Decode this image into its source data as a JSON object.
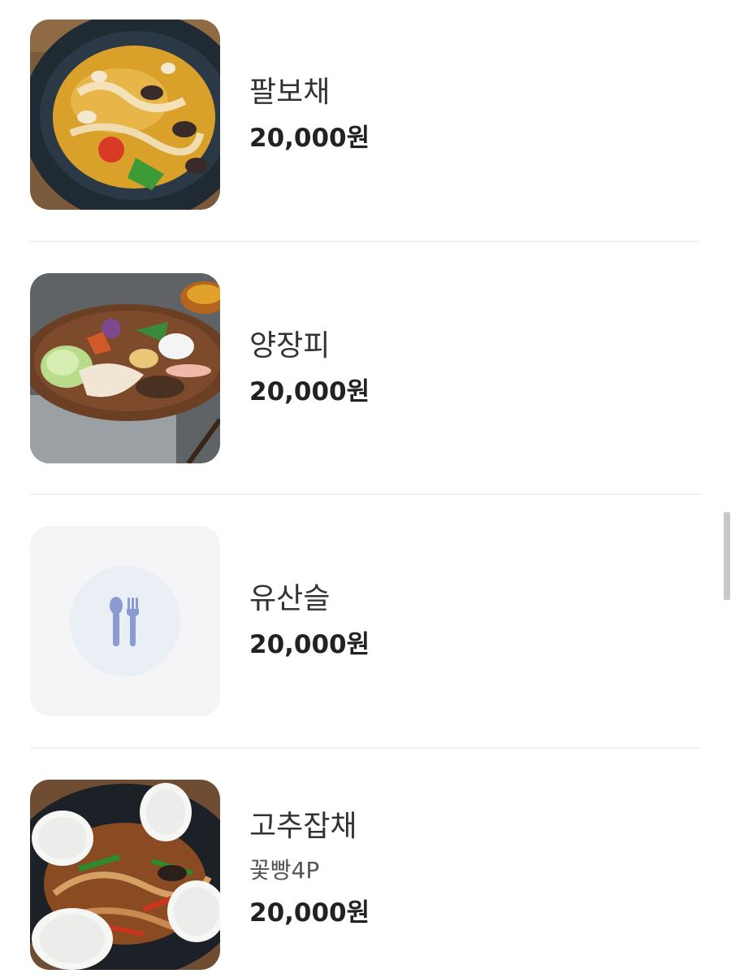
{
  "menu": {
    "items": [
      {
        "name": "팔보채",
        "price": "20,000원",
        "image": "stir-fry-seafood-photo"
      },
      {
        "name": "양장피",
        "price": "20,000원",
        "image": "cold-platter-photo"
      },
      {
        "name": "유산슬",
        "price": "20,000원",
        "image": "utensils-placeholder-icon"
      },
      {
        "name": "고추잡채",
        "description": "꽃빵4P",
        "price": "20,000원",
        "image": "pepper-stir-fry-with-buns-photo"
      }
    ]
  },
  "colors": {
    "divider": "#f1f1f1",
    "placeholder_bg": "#f5f5f7",
    "placeholder_circle": "#eaeef5",
    "utensil_icon": "#8a9bd1",
    "price_text": "#222222",
    "name_text": "#333333"
  }
}
